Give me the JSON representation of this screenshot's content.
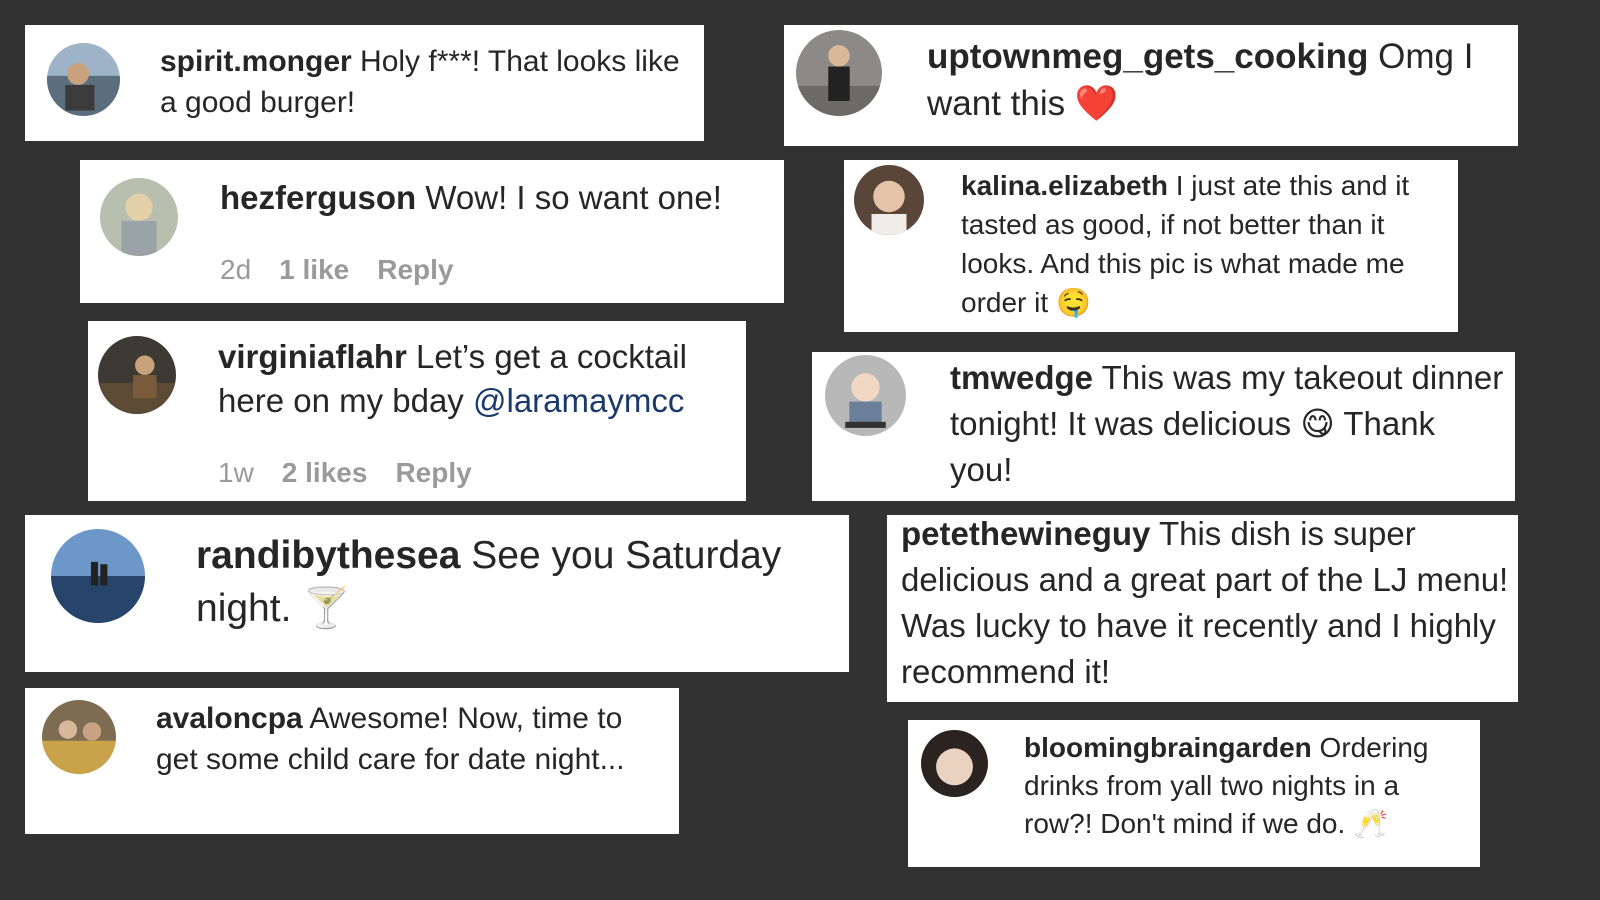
{
  "colors": {
    "background": "#323232",
    "card": "#ffffff",
    "text": "#262626",
    "meta": "#9a9a9a",
    "mention": "#1a3a6b"
  },
  "comments": [
    {
      "username": "spirit.monger",
      "text": " Holy f***! That looks like a good burger!",
      "avatar_icon": "lake-portrait-avatar-icon"
    },
    {
      "username": "uptownmeg_gets_cooking",
      "text": " Omg I want this ",
      "emoji": "❤️",
      "avatar_icon": "street-portrait-avatar-icon"
    },
    {
      "username": "hezferguson",
      "text": " Wow! I so want one!",
      "age": "2d",
      "likes": "1 like",
      "reply": "Reply",
      "avatar_icon": "outdoor-portrait-avatar-icon"
    },
    {
      "username": "kalina.elizabeth",
      "text": " I just ate this and it tasted as good, if not better than it looks. And this pic is what made me order it ",
      "emoji": "🤤",
      "avatar_icon": "selfie-avatar-icon"
    },
    {
      "username": "virginiaflahr",
      "text": " Let’s get a cocktail here on my bday ",
      "mention": "@laramaymcc",
      "age": "1w",
      "likes": "2 likes",
      "reply": "Reply",
      "avatar_icon": "sitting-portrait-avatar-icon"
    },
    {
      "username": "tmwedge",
      "text": " This was my takeout dinner tonight! It was delicious ",
      "emoji": "😋",
      "text_after": " Thank you!",
      "avatar_icon": "baby-swing-avatar-icon"
    },
    {
      "username": "randibythesea",
      "text": " See you Saturday night. ",
      "emoji": "🍸",
      "avatar_icon": "beach-avatar-icon"
    },
    {
      "username": "petethewineguy",
      "text": " This dish is super delicious and a great part of the LJ menu! Was lucky to have it recently and I highly recommend it!"
    },
    {
      "username": "avaloncpa",
      "text": " Awesome! Now, time to get some child care for date night...",
      "avatar_icon": "couch-group-avatar-icon"
    },
    {
      "username": "bloomingbraingarden",
      "text": " Ordering drinks from yall two nights in a row?! Don't mind if we do. ",
      "emoji": "🥂",
      "avatar_icon": "face-avatar-icon"
    }
  ]
}
